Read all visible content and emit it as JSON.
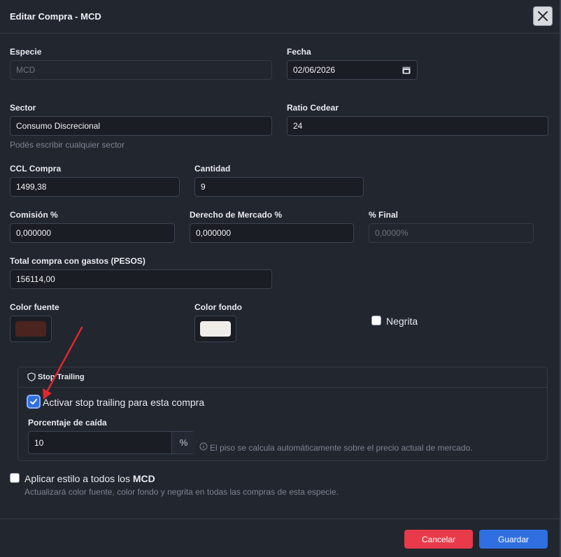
{
  "modal": {
    "title": "Editar Compra - MCD"
  },
  "fields": {
    "especie": {
      "label": "Especie",
      "value": "MCD"
    },
    "fecha": {
      "label": "Fecha",
      "value": "02/06/2026"
    },
    "sector": {
      "label": "Sector",
      "value": "Consumo Discrecional",
      "help": "Podés escribir cualquier sector"
    },
    "ratio": {
      "label": "Ratio Cedear",
      "value": "24"
    },
    "ccl": {
      "label": "CCL Compra",
      "value": "1499,38"
    },
    "cantidad": {
      "label": "Cantidad",
      "value": "9"
    },
    "comision": {
      "label": "Comisión %",
      "value": "0,000000"
    },
    "derecho": {
      "label": "Derecho de Mercado %",
      "value": "0,000000"
    },
    "final": {
      "label": "% Final",
      "placeholder": "0,0000%"
    },
    "total": {
      "label": "Total compra con gastos (PESOS)",
      "value": "156114,00"
    },
    "color_fuente": {
      "label": "Color fuente",
      "color": "#4a2520"
    },
    "color_fondo": {
      "label": "Color fondo",
      "color": "#efedea"
    },
    "negrita": {
      "label": "Negrita",
      "checked": false
    }
  },
  "stop_trailing": {
    "title": "Stop Trailing",
    "activate_label": "Activar stop trailing para esta compra",
    "activate_checked": true,
    "percent_label": "Porcentaje de caída",
    "percent_value": "10",
    "percent_suffix": "%",
    "info": "El piso se calcula automáticamente sobre el precio actual de mercado."
  },
  "apply_style": {
    "label_prefix": "Aplicar estilo a todos los ",
    "label_bold": "MCD",
    "checked": false,
    "help": "Actualizará color fuente, color fondo y negrita en todas las compras de esta especie."
  },
  "buttons": {
    "cancel": "Cancelar",
    "save": "Guardar"
  },
  "colors": {
    "cancel": "#e83a4a",
    "save": "#2f6fe0",
    "annotation_arrow": "#e0262f"
  },
  "icons": [
    "close-icon",
    "calendar-icon",
    "shield-icon",
    "check-icon",
    "info-icon",
    "arrow-annotation"
  ]
}
